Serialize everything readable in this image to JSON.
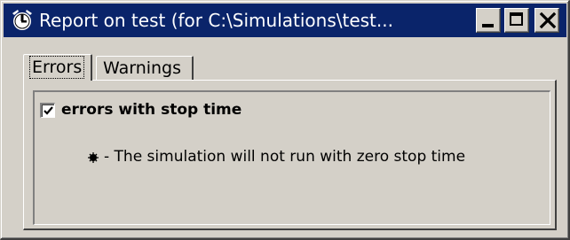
{
  "window": {
    "title": "Report on test (for C:\\Simulations\\test...",
    "controls": {
      "minimize_icon": "minimize-icon",
      "maximize_icon": "maximize-icon",
      "close_icon": "close-icon"
    }
  },
  "tabs": [
    {
      "label": "Errors",
      "selected": true
    },
    {
      "label": "Warnings",
      "selected": false
    }
  ],
  "errors_panel": {
    "section": {
      "label": "errors with stop time",
      "checked": true
    },
    "items": [
      {
        "text": "- The simulation will not run with zero stop time"
      }
    ]
  },
  "colors": {
    "titlebar": "#0a246a",
    "face": "#d4d0c8"
  }
}
